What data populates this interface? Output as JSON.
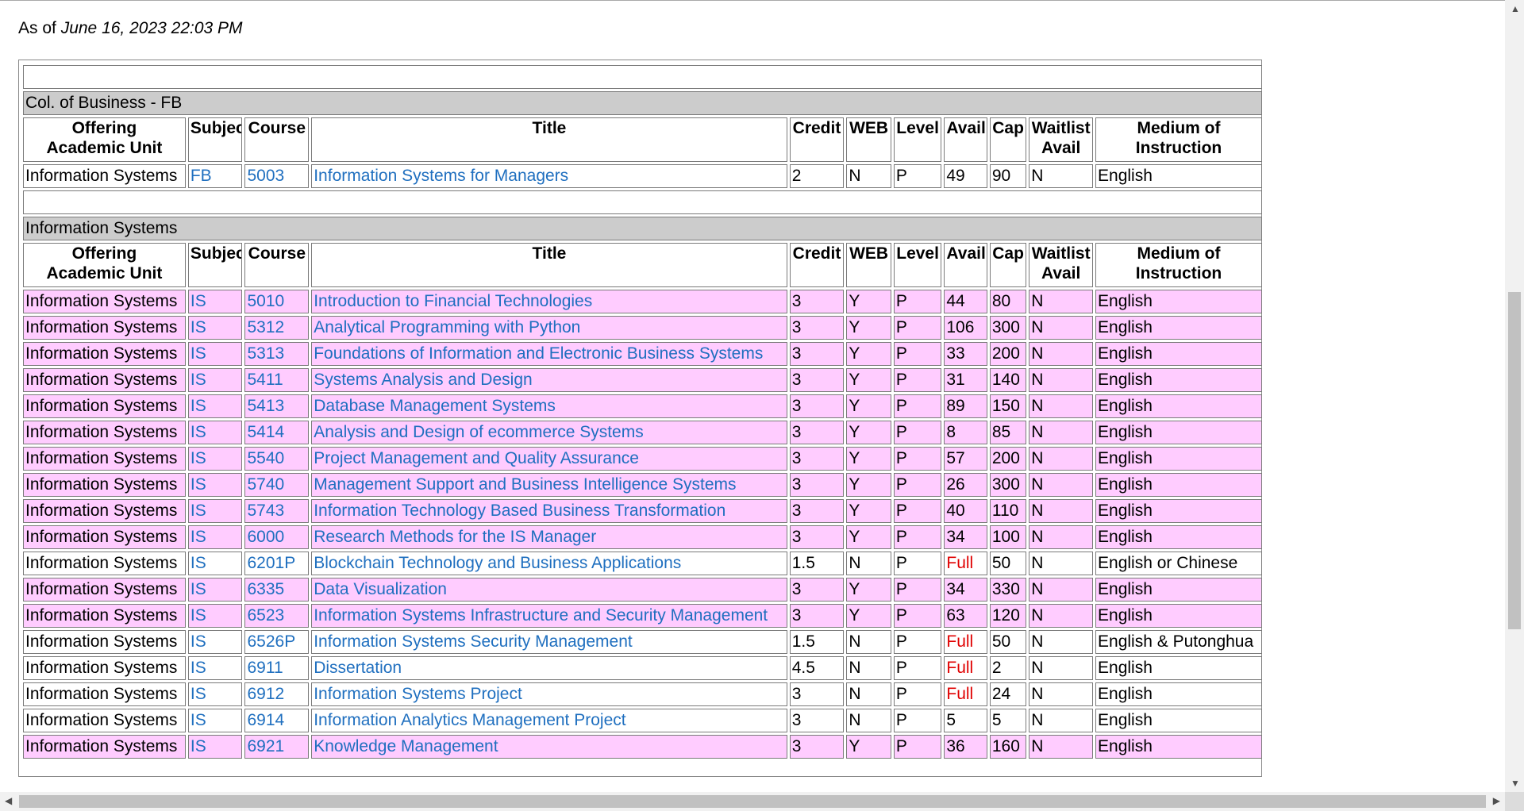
{
  "as_of": {
    "prefix": "As of",
    "datetime": "June 16, 2023 22:03 PM"
  },
  "headers": {
    "unit_line1": "Offering",
    "unit_line2": "Academic Unit",
    "subject": "Subject",
    "course": "Course",
    "title": "Title",
    "credit": "Credit",
    "web": "WEB",
    "level": "Level",
    "avail": "Avail",
    "cap": "Cap",
    "waitlist_line1": "Waitlist",
    "waitlist_line2": "Avail",
    "medium_line1": "Medium of",
    "medium_line2": "Instruction"
  },
  "sections": [
    {
      "name": "Col. of Business - FB",
      "rows": [
        {
          "unit": "Information Systems",
          "subject": "FB",
          "course": "5003",
          "title": "Information Systems for Managers",
          "credit": "2",
          "web": "N",
          "level": "P",
          "avail": "49",
          "cap": "90",
          "waitlist": "N",
          "medium": "English",
          "highlight": false
        }
      ]
    },
    {
      "name": "Information Systems",
      "rows": [
        {
          "unit": "Information Systems",
          "subject": "IS",
          "course": "5010",
          "title": "Introduction to Financial Technologies",
          "credit": "3",
          "web": "Y",
          "level": "P",
          "avail": "44",
          "cap": "80",
          "waitlist": "N",
          "medium": "English",
          "highlight": true
        },
        {
          "unit": "Information Systems",
          "subject": "IS",
          "course": "5312",
          "title": "Analytical Programming with Python",
          "credit": "3",
          "web": "Y",
          "level": "P",
          "avail": "106",
          "cap": "300",
          "waitlist": "N",
          "medium": "English",
          "highlight": true
        },
        {
          "unit": "Information Systems",
          "subject": "IS",
          "course": "5313",
          "title": "Foundations of Information and Electronic Business Systems",
          "credit": "3",
          "web": "Y",
          "level": "P",
          "avail": "33",
          "cap": "200",
          "waitlist": "N",
          "medium": "English",
          "highlight": true
        },
        {
          "unit": "Information Systems",
          "subject": "IS",
          "course": "5411",
          "title": "Systems Analysis and Design",
          "credit": "3",
          "web": "Y",
          "level": "P",
          "avail": "31",
          "cap": "140",
          "waitlist": "N",
          "medium": "English",
          "highlight": true
        },
        {
          "unit": "Information Systems",
          "subject": "IS",
          "course": "5413",
          "title": "Database Management Systems",
          "credit": "3",
          "web": "Y",
          "level": "P",
          "avail": "89",
          "cap": "150",
          "waitlist": "N",
          "medium": "English",
          "highlight": true
        },
        {
          "unit": "Information Systems",
          "subject": "IS",
          "course": "5414",
          "title": "Analysis and Design of ecommerce Systems",
          "credit": "3",
          "web": "Y",
          "level": "P",
          "avail": "8",
          "cap": "85",
          "waitlist": "N",
          "medium": "English",
          "highlight": true
        },
        {
          "unit": "Information Systems",
          "subject": "IS",
          "course": "5540",
          "title": "Project Management and Quality Assurance",
          "credit": "3",
          "web": "Y",
          "level": "P",
          "avail": "57",
          "cap": "200",
          "waitlist": "N",
          "medium": "English",
          "highlight": true
        },
        {
          "unit": "Information Systems",
          "subject": "IS",
          "course": "5740",
          "title": "Management Support and Business Intelligence Systems",
          "credit": "3",
          "web": "Y",
          "level": "P",
          "avail": "26",
          "cap": "300",
          "waitlist": "N",
          "medium": "English",
          "highlight": true
        },
        {
          "unit": "Information Systems",
          "subject": "IS",
          "course": "5743",
          "title": "Information Technology Based Business Transformation",
          "credit": "3",
          "web": "Y",
          "level": "P",
          "avail": "40",
          "cap": "110",
          "waitlist": "N",
          "medium": "English",
          "highlight": true
        },
        {
          "unit": "Information Systems",
          "subject": "IS",
          "course": "6000",
          "title": "Research Methods for the IS Manager",
          "credit": "3",
          "web": "Y",
          "level": "P",
          "avail": "34",
          "cap": "100",
          "waitlist": "N",
          "medium": "English",
          "highlight": true
        },
        {
          "unit": "Information Systems",
          "subject": "IS",
          "course": "6201P",
          "title": "Blockchain Technology and Business Applications",
          "credit": "1.5",
          "web": "N",
          "level": "P",
          "avail": "Full",
          "cap": "50",
          "waitlist": "N",
          "medium": "English or Chinese",
          "highlight": false
        },
        {
          "unit": "Information Systems",
          "subject": "IS",
          "course": "6335",
          "title": "Data Visualization",
          "credit": "3",
          "web": "Y",
          "level": "P",
          "avail": "34",
          "cap": "330",
          "waitlist": "N",
          "medium": "English",
          "highlight": true
        },
        {
          "unit": "Information Systems",
          "subject": "IS",
          "course": "6523",
          "title": "Information Systems Infrastructure and Security Management",
          "credit": "3",
          "web": "Y",
          "level": "P",
          "avail": "63",
          "cap": "120",
          "waitlist": "N",
          "medium": "English",
          "highlight": true
        },
        {
          "unit": "Information Systems",
          "subject": "IS",
          "course": "6526P",
          "title": "Information Systems Security Management",
          "credit": "1.5",
          "web": "N",
          "level": "P",
          "avail": "Full",
          "cap": "50",
          "waitlist": "N",
          "medium": "English & Putonghua",
          "highlight": false
        },
        {
          "unit": "Information Systems",
          "subject": "IS",
          "course": "6911",
          "title": "Dissertation",
          "credit": "4.5",
          "web": "N",
          "level": "P",
          "avail": "Full",
          "cap": "2",
          "waitlist": "N",
          "medium": "English",
          "highlight": false
        },
        {
          "unit": "Information Systems",
          "subject": "IS",
          "course": "6912",
          "title": "Information Systems Project",
          "credit": "3",
          "web": "N",
          "level": "P",
          "avail": "Full",
          "cap": "24",
          "waitlist": "N",
          "medium": "English",
          "highlight": false
        },
        {
          "unit": "Information Systems",
          "subject": "IS",
          "course": "6914",
          "title": "Information Analytics Management Project",
          "credit": "3",
          "web": "N",
          "level": "P",
          "avail": "5",
          "cap": "5",
          "waitlist": "N",
          "medium": "English",
          "highlight": false
        },
        {
          "unit": "Information Systems",
          "subject": "IS",
          "course": "6921",
          "title": "Knowledge Management",
          "credit": "3",
          "web": "Y",
          "level": "P",
          "avail": "36",
          "cap": "160",
          "waitlist": "N",
          "medium": "English",
          "highlight": true
        }
      ]
    }
  ],
  "colors": {
    "highlight_row": "#ffccff",
    "section_bar": "#cccccc",
    "link": "#1f6fbf",
    "full": "#e00000"
  }
}
